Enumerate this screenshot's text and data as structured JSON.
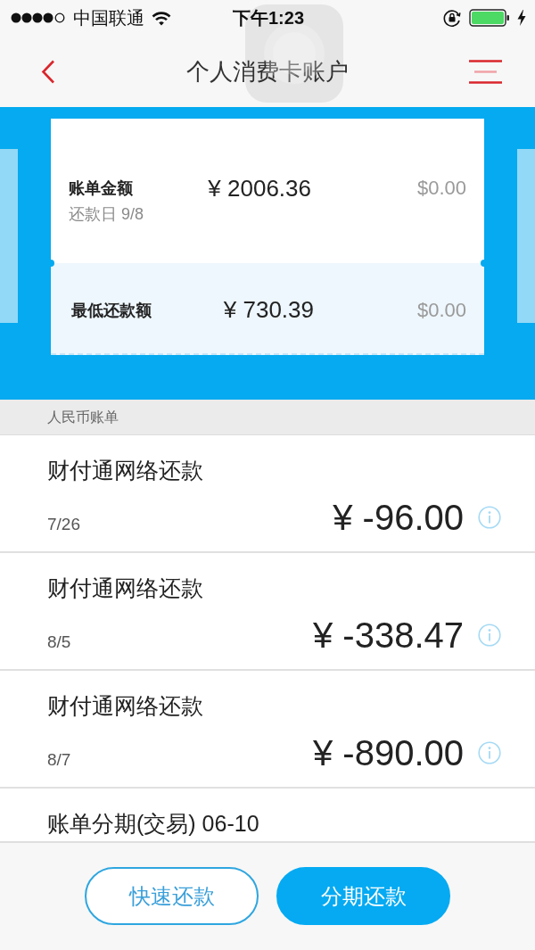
{
  "status_bar": {
    "carrier": "中国联通",
    "time": "下午1:23"
  },
  "nav_bar": {
    "title": "个人消费卡账户"
  },
  "bill_card": {
    "items": [
      {
        "kind": "statement",
        "label": "账单金额",
        "due_date": "还款日 9/8",
        "amount": "¥ 2006.36",
        "usd_amount": "$0.00"
      },
      {
        "kind": "minimum",
        "label": "最低还款额",
        "amount": "¥ 730.39",
        "usd_amount": "$0.00"
      }
    ]
  },
  "section_header": "人民币账单",
  "transactions": [
    {
      "title": "财付通网络还款",
      "date": "7/26",
      "amount": "¥ -96.00"
    },
    {
      "title": "财付通网络还款",
      "date": "8/5",
      "amount": "¥ -338.47"
    },
    {
      "title": "财付通网络还款",
      "date": "8/7",
      "amount": "¥ -890.00"
    },
    {
      "title": "账单分期(交易) 06-10"
    }
  ],
  "buttons": [
    {
      "label": "快速还款",
      "kind": "outline"
    },
    {
      "label": "分期还款",
      "kind": "filled"
    }
  ]
}
